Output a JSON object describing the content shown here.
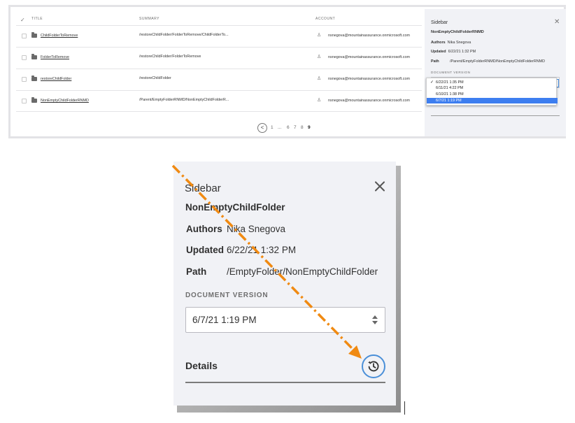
{
  "table": {
    "headers": {
      "title": "TITLE",
      "summary": "SUMMARY",
      "account": "ACCOUNT"
    },
    "rows": [
      {
        "title": "ChildFolderToRemove",
        "summary": "/restoreChildFolder/FolderToRemove/ChildFolderTo...",
        "account": "nsnegova@mountainassurance.onmicrosoft.com"
      },
      {
        "title": "FolderToRemove",
        "summary": "/restoreChildFolder/FolderToRemove",
        "account": "nsnegova@mountainassurance.onmicrosoft.com"
      },
      {
        "title": "restoreChildFolder",
        "summary": "/restoreChildFolder",
        "account": "nsnegova@mountainassurance.onmicrosoft.com"
      },
      {
        "title": "NonEmptyChildFolderRNMD",
        "summary": "/Parent/EmptyFolderRNMD/NonEmptyChildFolderR...",
        "account": "nsnegova@mountainassurance.onmicrosoft.com"
      }
    ],
    "pager": {
      "prev": "<",
      "pages": [
        "1",
        "...",
        "6",
        "7",
        "8",
        "9"
      ],
      "current": "9"
    }
  },
  "mini_sidebar": {
    "title": "Sidebar",
    "name": "NonEmptyChildFolderRNMD",
    "authors_label": "Authors",
    "authors_value": "Nika Snegova",
    "updated_label": "Updated",
    "updated_value": "6/22/21 1:32 PM",
    "path_label": "Path",
    "path_value": "/Parent/EmptyFolderRNMD/NonEmptyChildFolderRNMD",
    "document_version_label": "DOCUMENT VERSION",
    "versions": [
      "6/22/21 1:35 PM",
      "6/11/21 4:22 PM",
      "6/10/21 1:38 PM",
      "6/7/21 1:19 PM"
    ],
    "checked_version": "6/22/21 1:35 PM",
    "highlighted_version": "6/7/21 1:19 PM",
    "check_glyph": "✓"
  },
  "zoom_sidebar": {
    "title": "Sidebar",
    "name": "NonEmptyChildFolder",
    "authors_label": "Authors",
    "authors_value": "Nika Snegova",
    "updated_label": "Updated",
    "updated_value": "6/22/21 1:32 PM",
    "path_label": "Path",
    "path_value": "/EmptyFolder/NonEmptyChildFolder",
    "document_version_label": "DOCUMENT VERSION",
    "selected_version": "6/7/21 1:19 PM",
    "details_label": "Details",
    "history_icon": "history-icon"
  },
  "colors": {
    "panel_bg": "#f1f2f6",
    "accent_blue": "#4a8fd8",
    "highlight_blue": "#3d7ef0",
    "arrow_orange": "#f08a12"
  }
}
